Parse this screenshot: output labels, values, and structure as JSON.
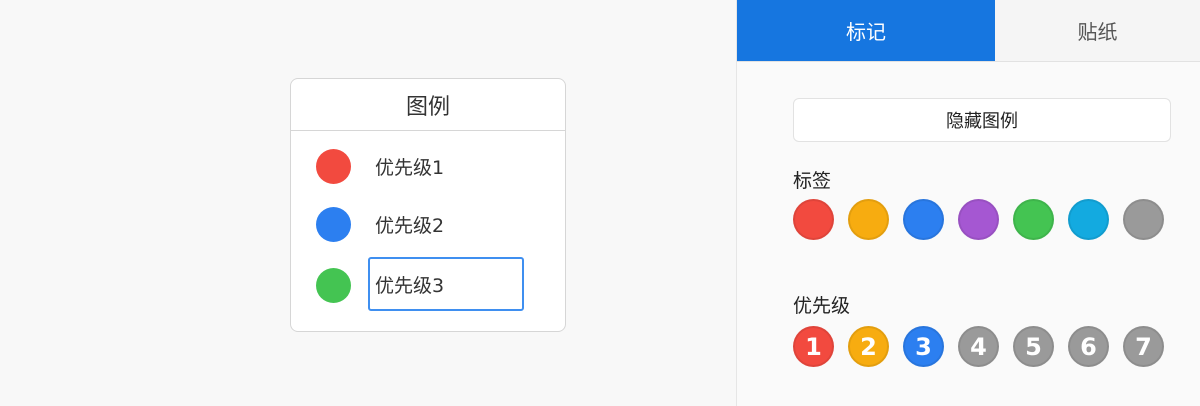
{
  "legend": {
    "title": "图例",
    "items": [
      {
        "label": "优先级1",
        "color": "#f24a3f"
      },
      {
        "label": "优先级2",
        "color": "#2c7ff0"
      },
      {
        "label": "优先级3",
        "color": "#44c452",
        "editing": true
      }
    ]
  },
  "panel": {
    "tabs": [
      {
        "label": "标记",
        "active": true
      },
      {
        "label": "贴纸",
        "active": false
      }
    ],
    "hide_legend_button": "隐藏图例",
    "tags": {
      "title": "标签",
      "colors": [
        "#f24a3f",
        "#f7ac10",
        "#2c7ff0",
        "#a557d2",
        "#44c452",
        "#13aae0",
        "#9a9a9a"
      ]
    },
    "priority": {
      "title": "优先级",
      "items": [
        {
          "number": "1",
          "color": "#f24a3f"
        },
        {
          "number": "2",
          "color": "#f7ac10"
        },
        {
          "number": "3",
          "color": "#2c7ff0"
        },
        {
          "number": "4",
          "color": "#9a9a9a"
        },
        {
          "number": "5",
          "color": "#9a9a9a"
        },
        {
          "number": "6",
          "color": "#9a9a9a"
        },
        {
          "number": "7",
          "color": "#9a9a9a"
        }
      ]
    }
  }
}
